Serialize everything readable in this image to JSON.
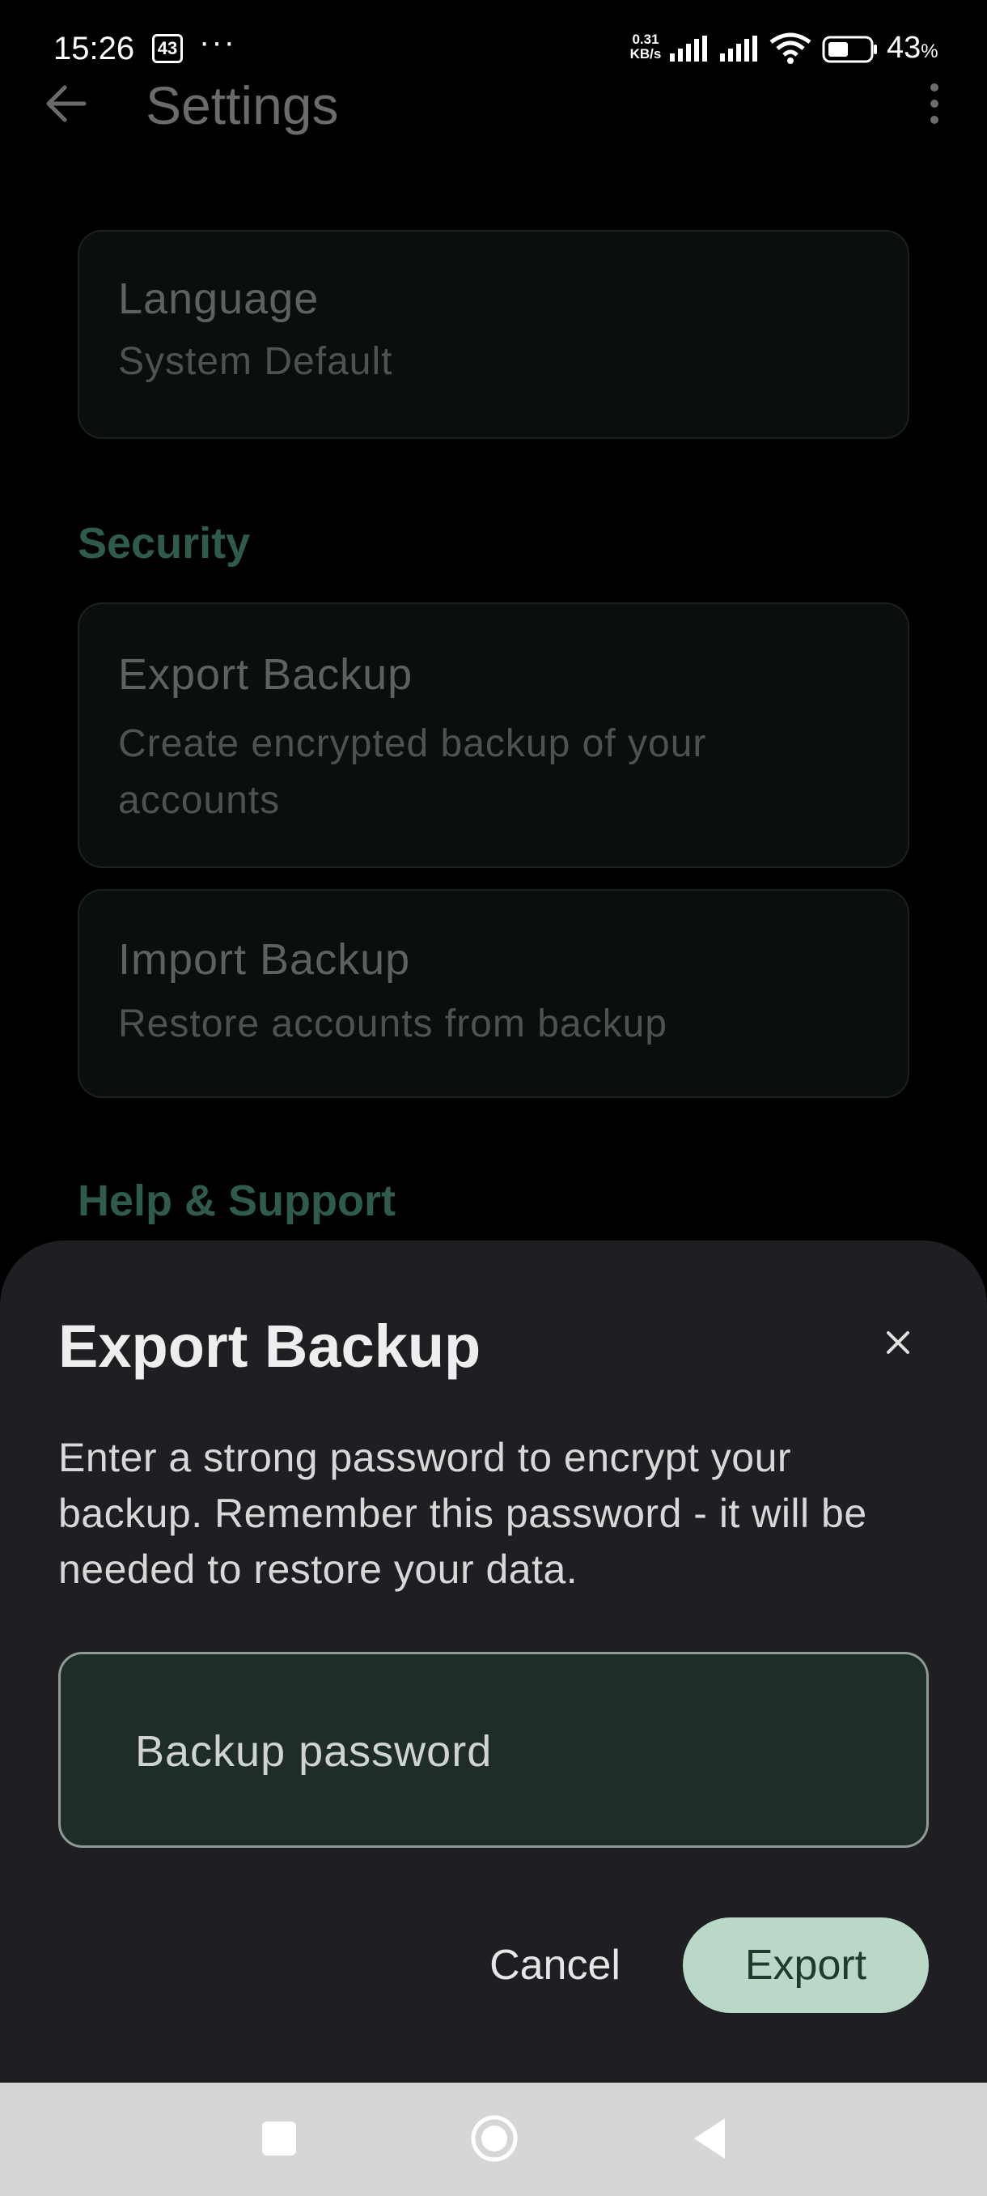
{
  "status_bar": {
    "time": "15:26",
    "badge": "43",
    "dots": "···",
    "speed_value": "0.31",
    "speed_unit": "KB/s",
    "battery_percent": "43",
    "percent_sign": "%"
  },
  "app_bar": {
    "title": "Settings",
    "back_icon": "arrow-left-icon",
    "menu_icon": "more-vert-icon"
  },
  "settings": {
    "language": {
      "title": "Language",
      "value": "System Default"
    },
    "security_header": "Security",
    "export_backup": {
      "title": "Export Backup",
      "subtitle": "Create encrypted backup of your accounts"
    },
    "import_backup": {
      "title": "Import Backup",
      "subtitle": "Restore accounts from backup"
    },
    "help_header": "Help & Support"
  },
  "dialog": {
    "title": "Export Backup",
    "description": "Enter a strong password to encrypt your backup. Remember this password - it will be needed to restore your data.",
    "password_placeholder": "Backup password",
    "password_value": "",
    "cancel_label": "Cancel",
    "export_label": "Export"
  },
  "colors": {
    "sheet_bg": "#1f1f23",
    "accent": "#b9d8c8",
    "field_bg": "#1e2d27",
    "section_header": "#2f5b4b"
  }
}
